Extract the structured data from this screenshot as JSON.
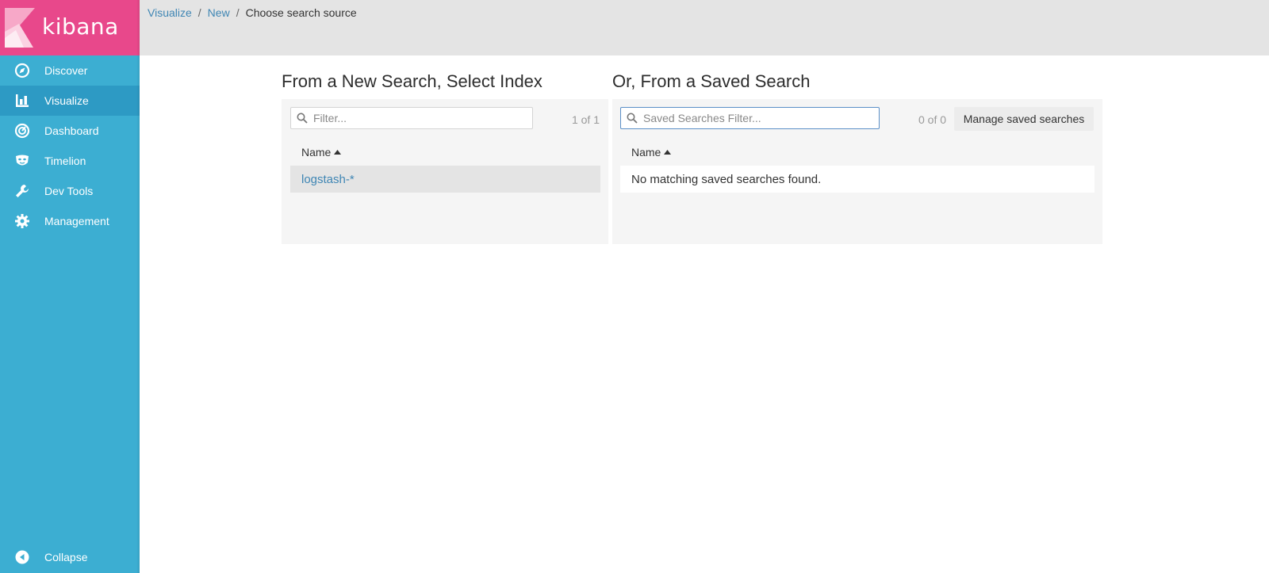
{
  "app": {
    "logo_text": "kibana"
  },
  "sidebar": {
    "items": [
      {
        "label": "Discover",
        "icon": "compass-icon",
        "active": false
      },
      {
        "label": "Visualize",
        "icon": "bar-chart-icon",
        "active": true
      },
      {
        "label": "Dashboard",
        "icon": "dashboard-gauge-icon",
        "active": false
      },
      {
        "label": "Timelion",
        "icon": "timelion-mask-icon",
        "active": false
      },
      {
        "label": "Dev Tools",
        "icon": "wrench-icon",
        "active": false
      },
      {
        "label": "Management",
        "icon": "gear-icon",
        "active": false
      }
    ],
    "collapse_label": "Collapse"
  },
  "breadcrumb": {
    "items": [
      "Visualize",
      "New"
    ],
    "current": "Choose search source",
    "separator": "/"
  },
  "left_panel": {
    "title": "From a New Search, Select Index",
    "filter_placeholder": "Filter...",
    "filter_value": "",
    "count": "1 of 1",
    "column": "Name",
    "rows": [
      "logstash-*"
    ]
  },
  "right_panel": {
    "title": "Or, From a Saved Search",
    "filter_placeholder": "Saved Searches Filter...",
    "filter_value": "",
    "count": "0 of 0",
    "manage_button": "Manage saved searches",
    "column": "Name",
    "empty_message": "No matching saved searches found."
  },
  "colors": {
    "sidebar": "#3caed2",
    "sidebar_active": "#2d9ac4",
    "logo_bg": "#e8488b",
    "link": "#3f86b4",
    "topbar": "#e4e4e4"
  }
}
